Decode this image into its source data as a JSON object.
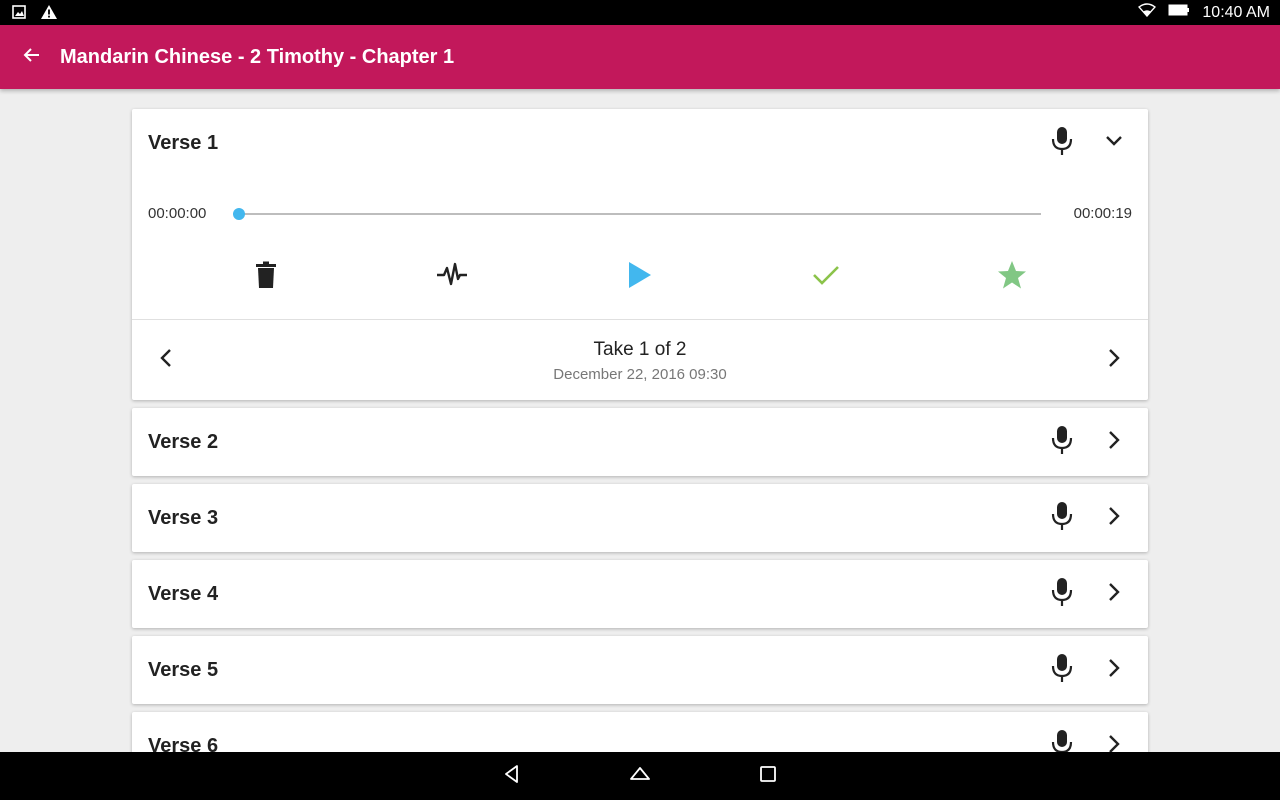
{
  "status_bar": {
    "time": "10:40 AM",
    "icons": [
      "image-notification-icon",
      "warning-icon",
      "wifi-icon",
      "battery-icon"
    ]
  },
  "app_bar": {
    "title": "Mandarin Chinese - 2 Timothy - Chapter 1",
    "back_icon": "arrow-back-icon"
  },
  "verses": [
    {
      "label": "Verse 1",
      "expanded": true,
      "player": {
        "time_start": "00:00:00",
        "time_end": "00:00:19",
        "progress": 0
      },
      "take": {
        "title": "Take 1 of 2",
        "date": "December 22, 2016  09:30"
      }
    },
    {
      "label": "Verse 2",
      "expanded": false
    },
    {
      "label": "Verse 3",
      "expanded": false
    },
    {
      "label": "Verse 4",
      "expanded": false
    },
    {
      "label": "Verse 5",
      "expanded": false
    },
    {
      "label": "Verse 6",
      "expanded": false
    }
  ],
  "colors": {
    "app_bar": "#c2185b",
    "accent_blue": "#42b7ee",
    "check_green": "#8bc34a",
    "star_green": "#81c784"
  }
}
